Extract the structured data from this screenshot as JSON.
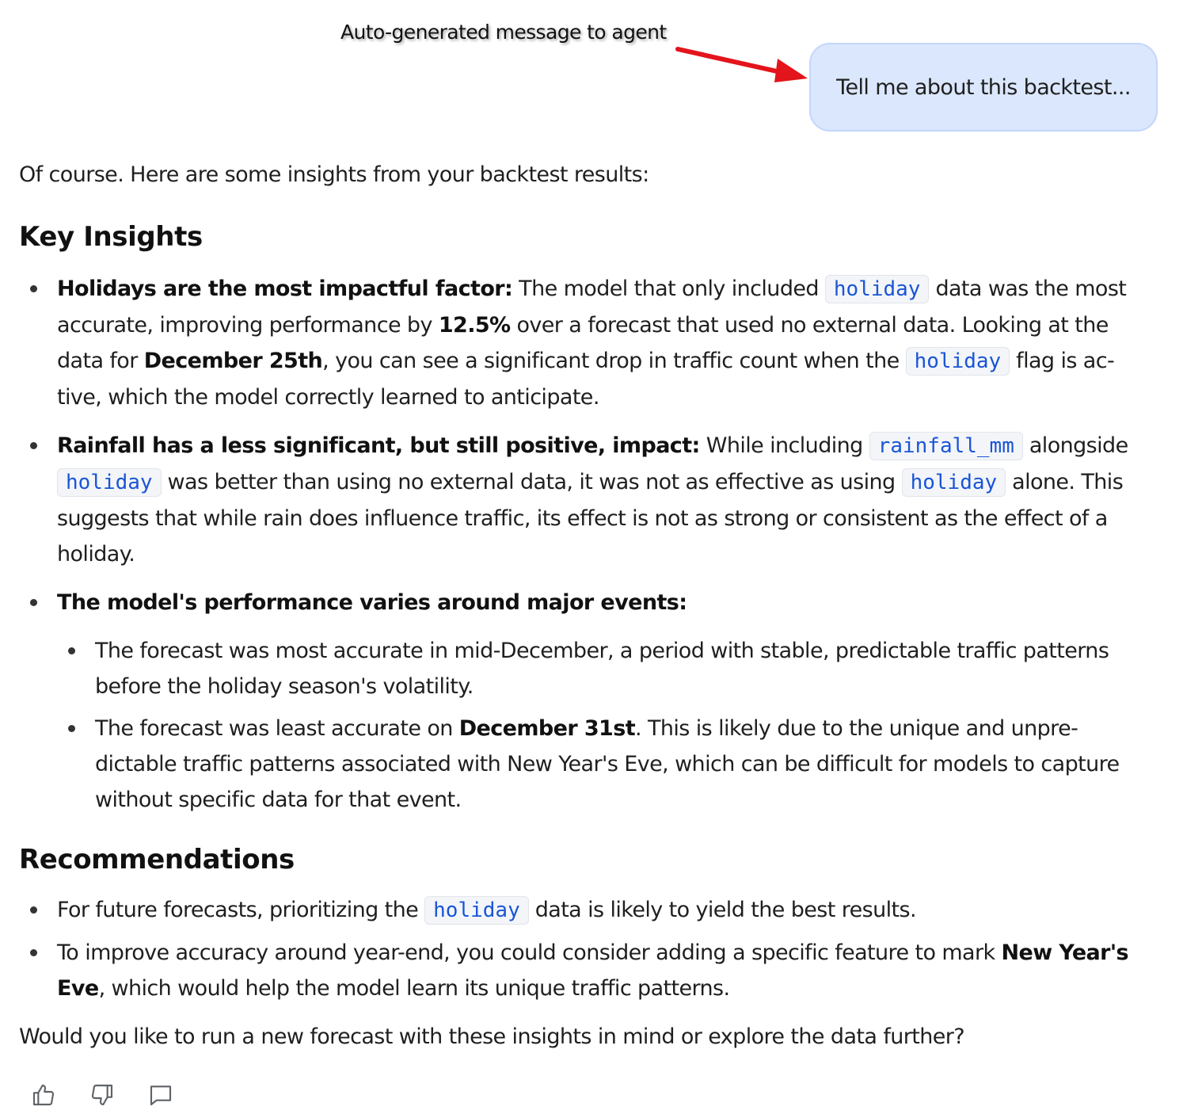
{
  "annotation": {
    "text": "Auto-generated message to agent",
    "arrow_color": "#e3141b"
  },
  "user_message": {
    "text": "Tell me about this backtest..."
  },
  "response": {
    "intro": "Of course. Here are some insights from your backtest results:",
    "key_insights": {
      "heading": "Key Insights",
      "item1": {
        "bold": "Holidays are the most impactful factor:",
        "t1": " The model that only included ",
        "code1": "holiday",
        "t2": " data was the most accurate, improving performance by ",
        "bold2": "12.5%",
        "t3": " over a forecast that used no external data. Looking at the data for ",
        "bold3": "December 25th",
        "t4": ", you can see a significant drop in traffic count when the ",
        "code2": "holiday",
        "t5": " flag is ac-tive, which the model correctly learned to anticipate."
      },
      "item2": {
        "bold": "Rainfall has a less significant, but still positive, impact:",
        "t1": " While including ",
        "code1": "rainfall_mm",
        "t2": " alongside ",
        "code2": "holiday",
        "t3": " was better than using no external data, it was not as effective as using ",
        "code3": "holiday",
        "t4": " alone. This suggests that while rain does influence traffic, its effect is not as strong or consistent as the effect of a holiday."
      },
      "item3": {
        "bold": "The model's performance varies around major events:",
        "sub1": "The forecast was most accurate in mid-December, a period with stable, predictable traffic patterns before the holiday season's volatility.",
        "sub2": {
          "t1": "The forecast was least accurate on ",
          "bold": "December 31st",
          "t2": ". This is likely due to the unique and unpre-dictable traffic patterns associated with New Year's Eve, which can be difficult for models to capture without specific data for that event."
        }
      }
    },
    "recommendations": {
      "heading": "Recommendations",
      "item1": {
        "t1": "For future forecasts, prioritizing the ",
        "code": "holiday",
        "t2": " data is likely to yield the best results."
      },
      "item2": {
        "t1": "To improve accuracy around year-end, you could consider adding a specific feature to mark ",
        "bold": "New Year's Eve",
        "t2": ", which would help the model learn its unique traffic patterns."
      }
    },
    "closing": "Would you like to run a new forecast with these insights in mind or explore the data further?"
  },
  "actions": {
    "icons": [
      "thumbs-up-icon",
      "thumbs-down-icon",
      "comment-icon"
    ]
  },
  "colors": {
    "bubble_bg": "#dbe7fd",
    "code_text": "#1a55d6",
    "arrow": "#e3141b"
  }
}
